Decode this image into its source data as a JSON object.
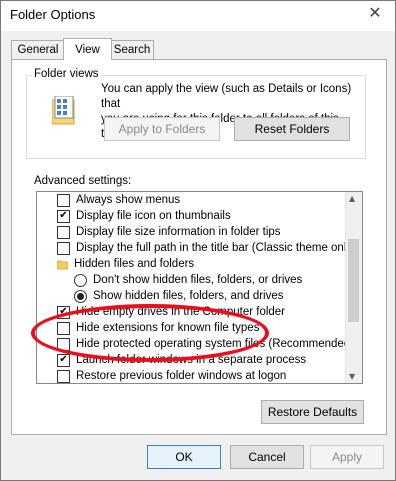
{
  "window": {
    "title": "Folder Options",
    "close_glyph": "✕"
  },
  "tabs": [
    {
      "label": "General"
    },
    {
      "label": "View"
    },
    {
      "label": "Search"
    }
  ],
  "folder_views": {
    "group_label": "Folder views",
    "description_line1": "You can apply the view (such as Details or Icons) that",
    "description_line2": "you are using for this folder to all folders of this type.",
    "apply_button": "Apply to Folders",
    "reset_button": "Reset Folders",
    "icon": "folder-view-icon"
  },
  "advanced": {
    "label": "Advanced settings:",
    "items": [
      {
        "type": "checkbox",
        "checked": false,
        "label": "Always show menus"
      },
      {
        "type": "checkbox",
        "checked": true,
        "label": "Display file icon on thumbnails"
      },
      {
        "type": "checkbox",
        "checked": false,
        "label": "Display file size information in folder tips"
      },
      {
        "type": "checkbox",
        "checked": false,
        "label": "Display the full path in the title bar (Classic theme only)"
      },
      {
        "type": "folder",
        "label": "Hidden files and folders"
      },
      {
        "type": "radio",
        "checked": false,
        "label": "Don't show hidden files, folders, or drives"
      },
      {
        "type": "radio",
        "checked": true,
        "label": "Show hidden files, folders, and drives"
      },
      {
        "type": "checkbox",
        "checked": true,
        "label": "Hide empty drives in the Computer folder"
      },
      {
        "type": "checkbox",
        "checked": false,
        "label": "Hide extensions for known file types"
      },
      {
        "type": "checkbox",
        "checked": false,
        "label": "Hide protected operating system files (Recommended)"
      },
      {
        "type": "checkbox",
        "checked": true,
        "label": "Launch folder windows in a separate process"
      },
      {
        "type": "checkbox",
        "checked": false,
        "label": "Restore previous folder windows at logon"
      }
    ],
    "restore_defaults": "Restore Defaults"
  },
  "footer": {
    "ok": "OK",
    "cancel": "Cancel",
    "apply": "Apply"
  },
  "colors": {
    "annotation": "#e8101e",
    "focus_border": "#3c7fb1"
  }
}
